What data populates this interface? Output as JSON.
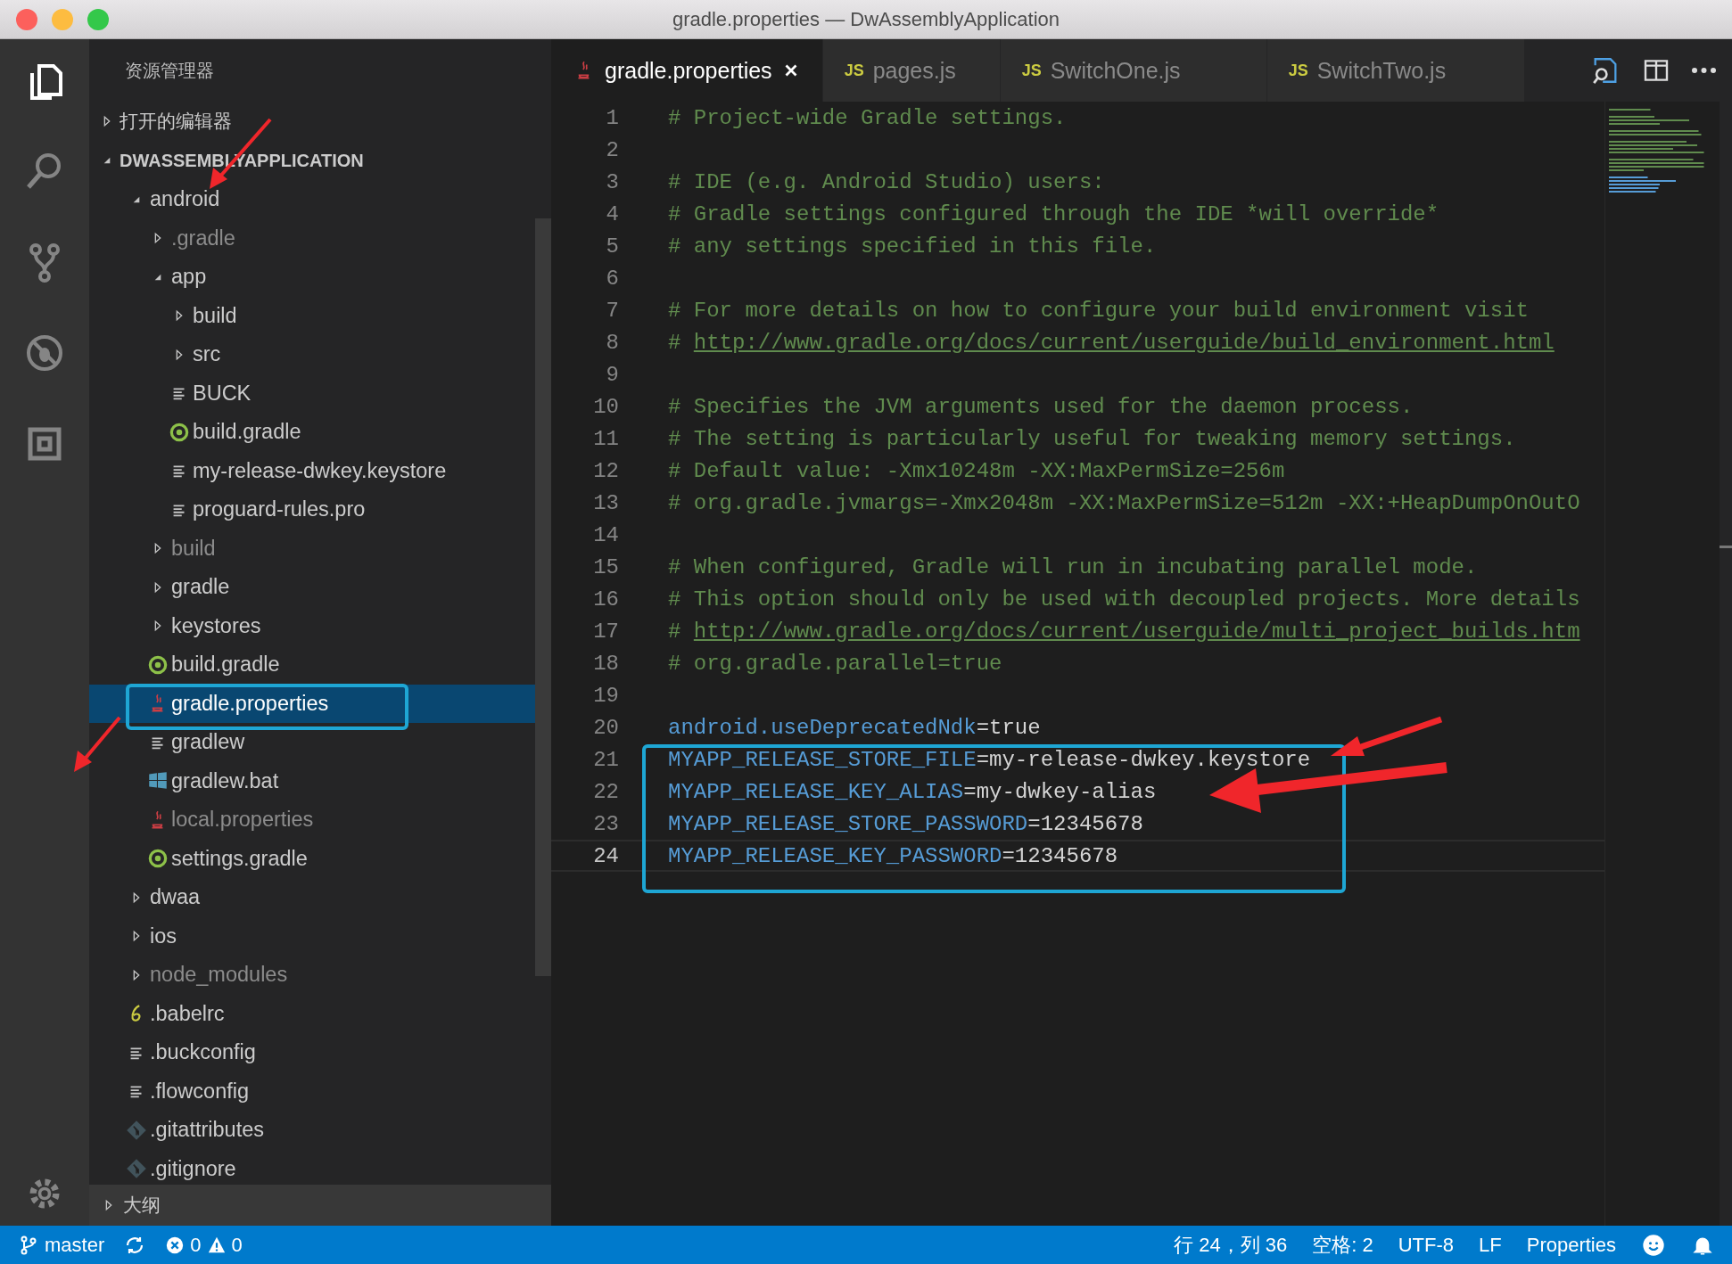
{
  "window": {
    "title": "gradle.properties — DwAssemblyApplication"
  },
  "activity_bar": [
    {
      "kind": "files",
      "selected": true
    },
    {
      "kind": "search",
      "selected": false
    },
    {
      "kind": "source-control",
      "selected": false
    },
    {
      "kind": "debug",
      "selected": false
    },
    {
      "kind": "extensions",
      "selected": false
    }
  ],
  "sidebar": {
    "title": "资源管理器",
    "open_editors": {
      "label": "打开的编辑器",
      "expanded": false
    },
    "project": {
      "label": "DWASSEMBLYAPPLICATION",
      "expanded": true,
      "items": [
        {
          "name": "android",
          "kind": "folder",
          "expanded": true,
          "ignored": false,
          "selected": false,
          "children": [
            {
              "name": ".gradle",
              "kind": "folder",
              "expanded": false,
              "ignored": true,
              "selected": false
            },
            {
              "name": "app",
              "kind": "folder",
              "expanded": true,
              "ignored": false,
              "selected": false,
              "children": [
                {
                  "name": "build",
                  "kind": "folder",
                  "expanded": false,
                  "ignored": false,
                  "selected": false
                },
                {
                  "name": "src",
                  "kind": "folder",
                  "expanded": false,
                  "ignored": false,
                  "selected": false
                },
                {
                  "name": "BUCK",
                  "kind": "text",
                  "ignored": false,
                  "selected": false
                },
                {
                  "name": "build.gradle",
                  "kind": "gradle",
                  "ignored": false,
                  "selected": false
                },
                {
                  "name": "my-release-dwkey.keystore",
                  "kind": "text",
                  "ignored": false,
                  "selected": false
                },
                {
                  "name": "proguard-rules.pro",
                  "kind": "text",
                  "ignored": false,
                  "selected": false
                }
              ]
            },
            {
              "name": "build",
              "kind": "folder",
              "expanded": false,
              "ignored": true,
              "selected": false
            },
            {
              "name": "gradle",
              "kind": "folder",
              "expanded": false,
              "ignored": false,
              "selected": false
            },
            {
              "name": "keystores",
              "kind": "folder",
              "expanded": false,
              "ignored": false,
              "selected": false
            },
            {
              "name": "build.gradle",
              "kind": "gradle",
              "ignored": false,
              "selected": false
            },
            {
              "name": "gradle.properties",
              "kind": "java",
              "ignored": false,
              "selected": true
            },
            {
              "name": "gradlew",
              "kind": "text",
              "ignored": false,
              "selected": false
            },
            {
              "name": "gradlew.bat",
              "kind": "windows",
              "ignored": false,
              "selected": false
            },
            {
              "name": "local.properties",
              "kind": "java",
              "ignored": true,
              "selected": false
            },
            {
              "name": "settings.gradle",
              "kind": "gradle",
              "ignored": false,
              "selected": false
            }
          ]
        },
        {
          "name": "dwaa",
          "kind": "folder",
          "expanded": false,
          "ignored": false,
          "selected": false
        },
        {
          "name": "ios",
          "kind": "folder",
          "expanded": false,
          "ignored": false,
          "selected": false
        },
        {
          "name": "node_modules",
          "kind": "folder",
          "expanded": false,
          "ignored": true,
          "selected": false
        },
        {
          "name": ".babelrc",
          "kind": "babel",
          "ignored": false,
          "selected": false
        },
        {
          "name": ".buckconfig",
          "kind": "text",
          "ignored": false,
          "selected": false
        },
        {
          "name": ".flowconfig",
          "kind": "text",
          "ignored": false,
          "selected": false
        },
        {
          "name": ".gitattributes",
          "kind": "git",
          "ignored": false,
          "selected": false
        },
        {
          "name": ".gitignore",
          "kind": "git",
          "ignored": false,
          "selected": false
        }
      ]
    },
    "outline": {
      "label": "大纲",
      "expanded": false
    }
  },
  "tabs": [
    {
      "label": "gradle.properties",
      "kind": "java",
      "selected": true
    },
    {
      "label": "pages.js",
      "kind": "js",
      "badge": "JS",
      "selected": false
    },
    {
      "label": "SwitchOne.js",
      "kind": "js",
      "badge": "JS",
      "selected": false
    },
    {
      "label": "SwitchTwo.js",
      "kind": "js",
      "badge": "JS",
      "selected": false
    }
  ],
  "lines": [
    {
      "number": "1",
      "kind": "comment",
      "text": "# Project-wide Gradle settings.",
      "current": false
    },
    {
      "number": "2",
      "kind": "blank",
      "current": false
    },
    {
      "number": "3",
      "kind": "comment",
      "text": "# IDE (e.g. Android Studio) users:",
      "current": false
    },
    {
      "number": "4",
      "kind": "comment",
      "text": "# Gradle settings configured through the IDE *will override*",
      "current": false
    },
    {
      "number": "5",
      "kind": "comment",
      "text": "# any settings specified in this file.",
      "current": false
    },
    {
      "number": "6",
      "kind": "blank",
      "current": false
    },
    {
      "number": "7",
      "kind": "comment",
      "text": "# For more details on how to configure your build environment visit",
      "current": false
    },
    {
      "number": "8",
      "kind": "link",
      "prefix": "# ",
      "url": "http://www.gradle.org/docs/current/userguide/build_environment.html",
      "current": false
    },
    {
      "number": "9",
      "kind": "blank",
      "current": false
    },
    {
      "number": "10",
      "kind": "comment",
      "text": "# Specifies the JVM arguments used for the daemon process.",
      "current": false
    },
    {
      "number": "11",
      "kind": "comment",
      "text": "# The setting is particularly useful for tweaking memory settings.",
      "current": false
    },
    {
      "number": "12",
      "kind": "comment",
      "text": "# Default value: -Xmx10248m -XX:MaxPermSize=256m",
      "current": false
    },
    {
      "number": "13",
      "kind": "comment",
      "text": "# org.gradle.jvmargs=-Xmx2048m -XX:MaxPermSize=512m -XX:+HeapDumpOnOutO",
      "current": false
    },
    {
      "number": "14",
      "kind": "blank",
      "current": false
    },
    {
      "number": "15",
      "kind": "comment",
      "text": "# When configured, Gradle will run in incubating parallel mode.",
      "current": false
    },
    {
      "number": "16",
      "kind": "comment",
      "text": "# This option should only be used with decoupled projects. More details",
      "current": false
    },
    {
      "number": "17",
      "kind": "link",
      "prefix": "# ",
      "url": "http://www.gradle.org/docs/current/userguide/multi_project_builds.htm",
      "current": false
    },
    {
      "number": "18",
      "kind": "comment",
      "text": "# org.gradle.parallel=true",
      "current": false
    },
    {
      "number": "19",
      "kind": "blank",
      "current": false
    },
    {
      "number": "20",
      "kind": "property",
      "key": "android.useDeprecatedNdk",
      "value": "=true",
      "current": false
    },
    {
      "number": "21",
      "kind": "property",
      "key": "MYAPP_RELEASE_STORE_FILE",
      "value": "=my-release-dwkey.keystore",
      "current": false
    },
    {
      "number": "22",
      "kind": "property",
      "key": "MYAPP_RELEASE_KEY_ALIAS",
      "value": "=my-dwkey-alias",
      "current": false
    },
    {
      "number": "23",
      "kind": "property",
      "key": "MYAPP_RELEASE_STORE_PASSWORD",
      "value": "=12345678",
      "current": false
    },
    {
      "number": "24",
      "kind": "property",
      "key": "MYAPP_RELEASE_KEY_PASSWORD",
      "value": "=12345678",
      "current": true
    }
  ],
  "status_bar": {
    "branch": "master",
    "errors": "0",
    "warnings": "0",
    "position": "行 24，列 36",
    "indent": "空格: 2",
    "encoding": "UTF-8",
    "eol": "LF",
    "language": "Properties"
  }
}
